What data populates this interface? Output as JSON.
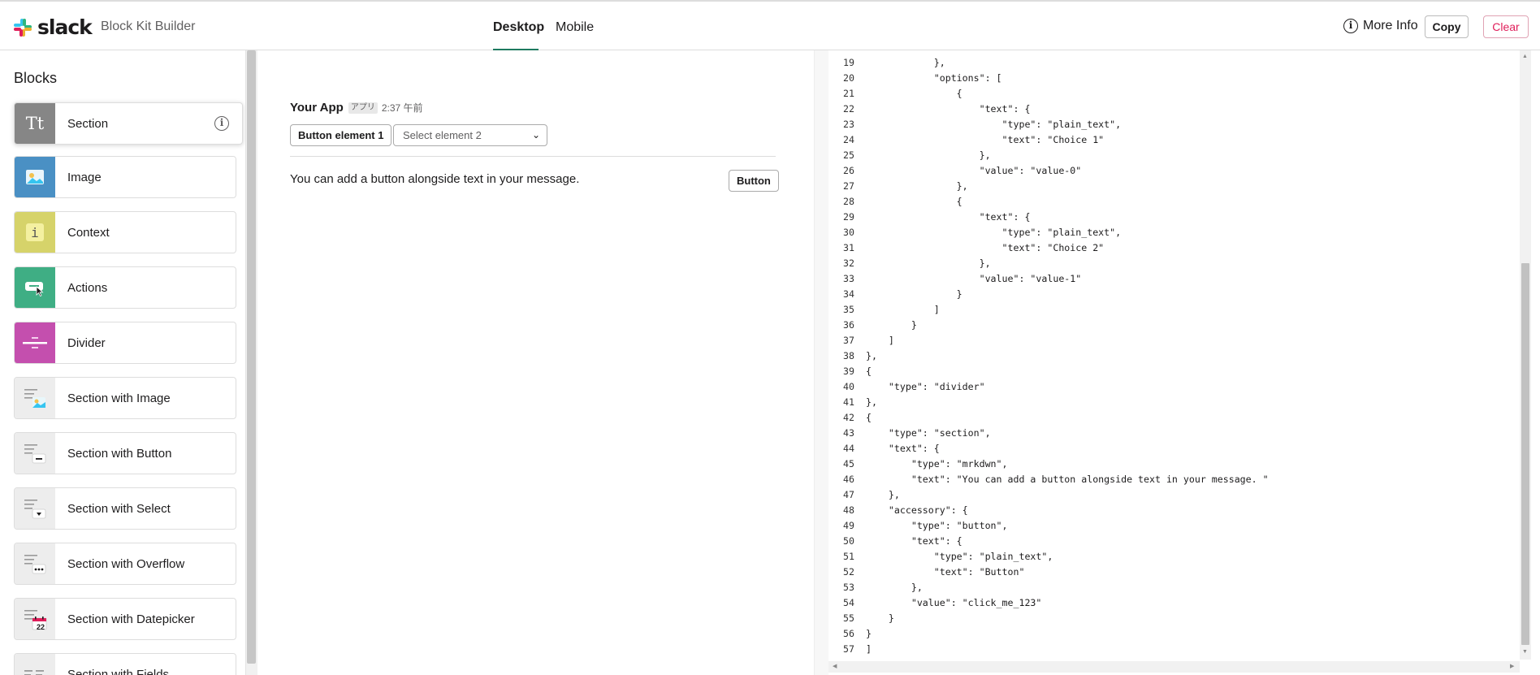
{
  "header": {
    "logo_text": "slack",
    "app_title": "Block Kit Builder",
    "tabs": [
      {
        "label": "Desktop",
        "active": true
      },
      {
        "label": "Mobile",
        "active": false
      }
    ],
    "more_info_label": "More Info",
    "copy_label": "Copy",
    "clear_label": "Clear"
  },
  "sidebar": {
    "heading": "Blocks",
    "items": [
      {
        "label": "Section",
        "icon": "text-format-icon",
        "icon_bg": "#868686"
      },
      {
        "label": "Image",
        "icon": "image-icon",
        "icon_bg": "#4a90c4"
      },
      {
        "label": "Context",
        "icon": "info-icon",
        "icon_bg": "#d6d36a"
      },
      {
        "label": "Actions",
        "icon": "button-cursor-icon",
        "icon_bg": "#3fae84"
      },
      {
        "label": "Divider",
        "icon": "divider-icon",
        "icon_bg": "#c44fae"
      },
      {
        "label": "Section with Image",
        "icon": "section-image-icon",
        "icon_bg": "#ededed"
      },
      {
        "label": "Section with Button",
        "icon": "section-button-icon",
        "icon_bg": "#ededed"
      },
      {
        "label": "Section with Select",
        "icon": "section-select-icon",
        "icon_bg": "#ededed"
      },
      {
        "label": "Section with Overflow",
        "icon": "section-overflow-icon",
        "icon_bg": "#ededed"
      },
      {
        "label": "Section with Datepicker",
        "icon": "section-datepicker-icon",
        "icon_bg": "#ededed",
        "date_number": "22"
      },
      {
        "label": "Section with Fields",
        "icon": "section-fields-icon",
        "icon_bg": "#ededed"
      }
    ]
  },
  "preview": {
    "app_name": "Your App",
    "app_badge": "アプリ",
    "time": "2:37 午前",
    "button_element": "Button element 1",
    "select_element": "Select element 2",
    "section_text": "You can add a button alongside text in your message.",
    "accessory_button": "Button"
  },
  "editor": {
    "lines": [
      {
        "n": "19",
        "text": "            },"
      },
      {
        "n": "20",
        "text": "            \"options\": ["
      },
      {
        "n": "21",
        "text": "                {"
      },
      {
        "n": "22",
        "text": "                    \"text\": {"
      },
      {
        "n": "23",
        "text": "                        \"type\": \"plain_text\","
      },
      {
        "n": "24",
        "text": "                        \"text\": \"Choice 1\""
      },
      {
        "n": "25",
        "text": "                    },"
      },
      {
        "n": "26",
        "text": "                    \"value\": \"value-0\""
      },
      {
        "n": "27",
        "text": "                },"
      },
      {
        "n": "28",
        "text": "                {"
      },
      {
        "n": "29",
        "text": "                    \"text\": {"
      },
      {
        "n": "30",
        "text": "                        \"type\": \"plain_text\","
      },
      {
        "n": "31",
        "text": "                        \"text\": \"Choice 2\""
      },
      {
        "n": "32",
        "text": "                    },"
      },
      {
        "n": "33",
        "text": "                    \"value\": \"value-1\""
      },
      {
        "n": "34",
        "text": "                }"
      },
      {
        "n": "35",
        "text": "            ]"
      },
      {
        "n": "36",
        "text": "        }"
      },
      {
        "n": "37",
        "text": "    ]"
      },
      {
        "n": "38",
        "text": "},"
      },
      {
        "n": "39",
        "text": "{"
      },
      {
        "n": "40",
        "text": "    \"type\": \"divider\""
      },
      {
        "n": "41",
        "text": "},"
      },
      {
        "n": "42",
        "text": "{"
      },
      {
        "n": "43",
        "text": "    \"type\": \"section\","
      },
      {
        "n": "44",
        "text": "    \"text\": {"
      },
      {
        "n": "45",
        "text": "        \"type\": \"mrkdwn\","
      },
      {
        "n": "46",
        "text": "        \"text\": \"You can add a button alongside text in your message. \""
      },
      {
        "n": "47",
        "text": "    },"
      },
      {
        "n": "48",
        "text": "    \"accessory\": {"
      },
      {
        "n": "49",
        "text": "        \"type\": \"button\","
      },
      {
        "n": "50",
        "text": "        \"text\": {"
      },
      {
        "n": "51",
        "text": "            \"type\": \"plain_text\","
      },
      {
        "n": "52",
        "text": "            \"text\": \"Button\""
      },
      {
        "n": "53",
        "text": "        },"
      },
      {
        "n": "54",
        "text": "        \"value\": \"click_me_123\""
      },
      {
        "n": "55",
        "text": "    }"
      },
      {
        "n": "56",
        "text": "}"
      },
      {
        "n": "57",
        "text": "]"
      }
    ]
  }
}
